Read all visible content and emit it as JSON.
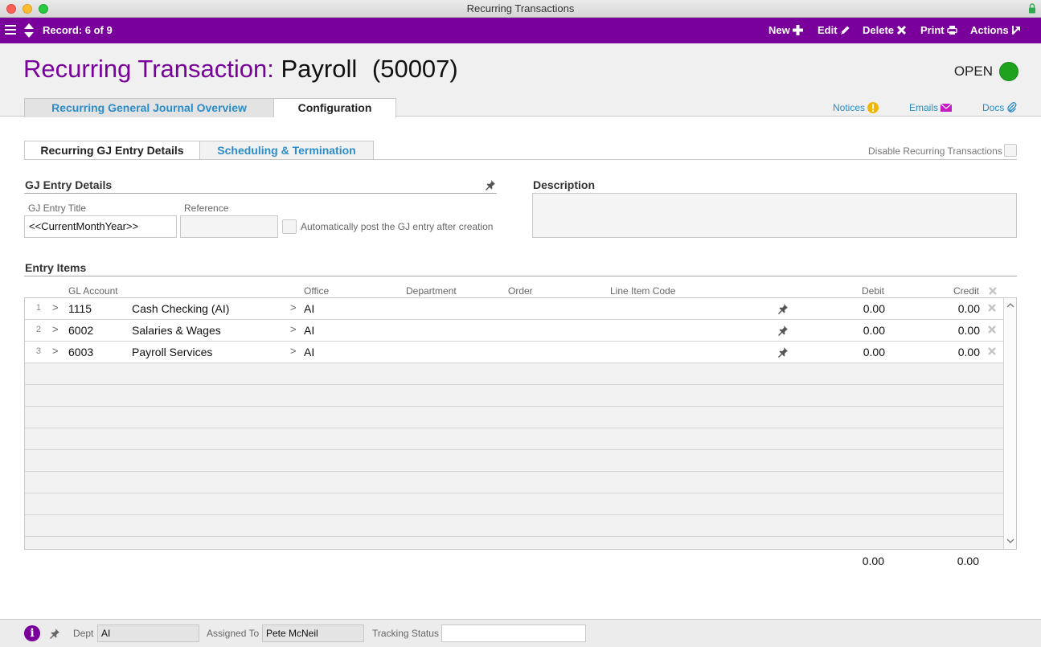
{
  "window": {
    "title": "Recurring Transactions"
  },
  "toolbar": {
    "record": "Record: 6 of 9",
    "new": "New",
    "edit": "Edit",
    "delete": "Delete",
    "print": "Print",
    "actions": "Actions"
  },
  "header": {
    "title_prefix": "Recurring Transaction:",
    "title_name": "Payroll",
    "title_id": "(50007)",
    "status": "OPEN",
    "status_color": "#1fa31f"
  },
  "main_tabs": [
    {
      "label": "Recurring General Journal Overview",
      "active": false
    },
    {
      "label": "Configuration",
      "active": true
    }
  ],
  "header_links": {
    "notices": "Notices",
    "emails": "Emails",
    "docs": "Docs"
  },
  "sub_tabs": [
    {
      "label": "Recurring GJ Entry Details",
      "active": true
    },
    {
      "label": "Scheduling & Termination",
      "active": false
    }
  ],
  "disable_recurring": {
    "label": "Disable Recurring Transactions",
    "checked": false
  },
  "gj_entry": {
    "section_title": "GJ Entry Details",
    "title_label": "GJ Entry Title",
    "title_value": "<<CurrentMonthYear>>",
    "reference_label": "Reference",
    "reference_value": "",
    "auto_post_label": "Automatically post the GJ entry after creation",
    "auto_post_checked": false
  },
  "description": {
    "section_title": "Description",
    "value": ""
  },
  "entry_items": {
    "section_title": "Entry Items",
    "columns": {
      "gl_account": "GL Account",
      "office": "Office",
      "department": "Department",
      "order": "Order",
      "line_item_code": "Line Item Code",
      "debit": "Debit",
      "credit": "Credit"
    },
    "rows": [
      {
        "num": "1",
        "account": "1115",
        "account_name": "Cash Checking (AI)",
        "office": "AI",
        "debit": "0.00",
        "credit": "0.00"
      },
      {
        "num": "2",
        "account": "6002",
        "account_name": "Salaries & Wages",
        "office": "AI",
        "debit": "0.00",
        "credit": "0.00"
      },
      {
        "num": "3",
        "account": "6003",
        "account_name": "Payroll Services",
        "office": "AI",
        "debit": "0.00",
        "credit": "0.00"
      }
    ],
    "total_debit": "0.00",
    "total_credit": "0.00"
  },
  "footer": {
    "dept_label": "Dept",
    "dept_value": "AI",
    "assigned_label": "Assigned To",
    "assigned_value": "Pete McNeil",
    "tracking_label": "Tracking Status",
    "tracking_value": ""
  },
  "colors": {
    "brand": "#7a009c",
    "link": "#2b8cc8"
  }
}
